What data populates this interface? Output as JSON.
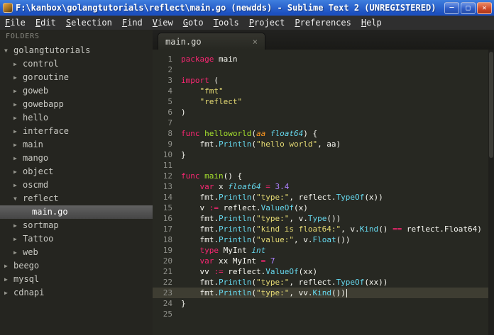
{
  "window": {
    "title": "F:\\kanbox\\golangtutorials\\reflect\\main.go (newdds) - Sublime Text 2 (UNREGISTERED)",
    "controls": {
      "minimize": "─",
      "maximize": "□",
      "close": "✕"
    }
  },
  "menu_items": [
    "File",
    "Edit",
    "Selection",
    "Find",
    "View",
    "Goto",
    "Tools",
    "Project",
    "Preferences",
    "Help"
  ],
  "sidebar": {
    "header": "FOLDERS",
    "items": [
      {
        "label": "golangtutorials",
        "level": 0,
        "type": "folder",
        "state": "expanded"
      },
      {
        "label": "control",
        "level": 1,
        "type": "folder",
        "state": "collapsed"
      },
      {
        "label": "goroutine",
        "level": 1,
        "type": "folder",
        "state": "collapsed"
      },
      {
        "label": "goweb",
        "level": 1,
        "type": "folder",
        "state": "collapsed"
      },
      {
        "label": "gowebapp",
        "level": 1,
        "type": "folder",
        "state": "collapsed"
      },
      {
        "label": "hello",
        "level": 1,
        "type": "folder",
        "state": "collapsed"
      },
      {
        "label": "interface",
        "level": 1,
        "type": "folder",
        "state": "collapsed"
      },
      {
        "label": "main",
        "level": 1,
        "type": "folder",
        "state": "collapsed"
      },
      {
        "label": "mango",
        "level": 1,
        "type": "folder",
        "state": "collapsed"
      },
      {
        "label": "object",
        "level": 1,
        "type": "folder",
        "state": "collapsed"
      },
      {
        "label": "oscmd",
        "level": 1,
        "type": "folder",
        "state": "collapsed"
      },
      {
        "label": "reflect",
        "level": 1,
        "type": "folder",
        "state": "expanded"
      },
      {
        "label": "main.go",
        "level": 2,
        "type": "file",
        "selected": true
      },
      {
        "label": "sortmap",
        "level": 1,
        "type": "folder",
        "state": "collapsed"
      },
      {
        "label": "Tattoo",
        "level": 1,
        "type": "folder",
        "state": "collapsed"
      },
      {
        "label": "web",
        "level": 1,
        "type": "folder",
        "state": "collapsed"
      },
      {
        "label": "beego",
        "level": 0,
        "type": "folder",
        "state": "collapsed"
      },
      {
        "label": "mysql",
        "level": 0,
        "type": "folder",
        "state": "collapsed"
      },
      {
        "label": "cdnapi",
        "level": 0,
        "type": "folder",
        "state": "collapsed"
      }
    ]
  },
  "tab": {
    "label": "main.go",
    "close_glyph": "×"
  },
  "editor": {
    "cursor_line": 23,
    "lines": [
      [
        [
          "package",
          "k"
        ],
        [
          " main",
          "p"
        ]
      ],
      [],
      [
        [
          "import",
          "k"
        ],
        [
          " (",
          "p"
        ]
      ],
      [
        [
          "    ",
          "p"
        ],
        [
          "\"fmt\"",
          "s"
        ]
      ],
      [
        [
          "    ",
          "p"
        ],
        [
          "\"reflect\"",
          "s"
        ]
      ],
      [
        [
          ")",
          "p"
        ]
      ],
      [],
      [
        [
          "func",
          "k"
        ],
        [
          " ",
          "p"
        ],
        [
          "helloworld",
          "f"
        ],
        [
          "(",
          "p"
        ],
        [
          "aa",
          "a"
        ],
        [
          " ",
          "p"
        ],
        [
          "float64",
          "t"
        ],
        [
          ") {",
          "p"
        ]
      ],
      [
        [
          "    fmt.",
          "p"
        ],
        [
          "Println",
          "b"
        ],
        [
          "(",
          "p"
        ],
        [
          "\"hello world\"",
          "s"
        ],
        [
          ", aa)",
          "p"
        ]
      ],
      [
        [
          "}",
          "p"
        ]
      ],
      [],
      [
        [
          "func",
          "k"
        ],
        [
          " ",
          "p"
        ],
        [
          "main",
          "f"
        ],
        [
          "() {",
          "p"
        ]
      ],
      [
        [
          "    ",
          "p"
        ],
        [
          "var",
          "k"
        ],
        [
          " x ",
          "p"
        ],
        [
          "float64",
          "t"
        ],
        [
          " ",
          "p"
        ],
        [
          "=",
          "o"
        ],
        [
          " ",
          "p"
        ],
        [
          "3.4",
          "n"
        ]
      ],
      [
        [
          "    fmt.",
          "p"
        ],
        [
          "Println",
          "b"
        ],
        [
          "(",
          "p"
        ],
        [
          "\"type:\"",
          "s"
        ],
        [
          ", reflect.",
          "p"
        ],
        [
          "TypeOf",
          "b"
        ],
        [
          "(x))",
          "p"
        ]
      ],
      [
        [
          "    v ",
          "p"
        ],
        [
          ":=",
          "o"
        ],
        [
          " reflect.",
          "p"
        ],
        [
          "ValueOf",
          "b"
        ],
        [
          "(x)",
          "p"
        ]
      ],
      [
        [
          "    fmt.",
          "p"
        ],
        [
          "Println",
          "b"
        ],
        [
          "(",
          "p"
        ],
        [
          "\"type:\"",
          "s"
        ],
        [
          ", v.",
          "p"
        ],
        [
          "Type",
          "b"
        ],
        [
          "())",
          "p"
        ]
      ],
      [
        [
          "    fmt.",
          "p"
        ],
        [
          "Println",
          "b"
        ],
        [
          "(",
          "p"
        ],
        [
          "\"kind is float64:\"",
          "s"
        ],
        [
          ", v.",
          "p"
        ],
        [
          "Kind",
          "b"
        ],
        [
          "() ",
          "p"
        ],
        [
          "==",
          "o"
        ],
        [
          " reflect.Float64)",
          "p"
        ]
      ],
      [
        [
          "    fmt.",
          "p"
        ],
        [
          "Println",
          "b"
        ],
        [
          "(",
          "p"
        ],
        [
          "\"value:\"",
          "s"
        ],
        [
          ", v.",
          "p"
        ],
        [
          "Float",
          "b"
        ],
        [
          "())",
          "p"
        ]
      ],
      [
        [
          "    ",
          "p"
        ],
        [
          "type",
          "k"
        ],
        [
          " MyInt ",
          "p"
        ],
        [
          "int",
          "t"
        ]
      ],
      [
        [
          "    ",
          "p"
        ],
        [
          "var",
          "k"
        ],
        [
          " xx MyInt ",
          "p"
        ],
        [
          "=",
          "o"
        ],
        [
          " ",
          "p"
        ],
        [
          "7",
          "n"
        ]
      ],
      [
        [
          "    vv ",
          "p"
        ],
        [
          ":=",
          "o"
        ],
        [
          " reflect.",
          "p"
        ],
        [
          "ValueOf",
          "b"
        ],
        [
          "(xx)",
          "p"
        ]
      ],
      [
        [
          "    fmt.",
          "p"
        ],
        [
          "Println",
          "b"
        ],
        [
          "(",
          "p"
        ],
        [
          "\"type:\"",
          "s"
        ],
        [
          ", reflect.",
          "p"
        ],
        [
          "TypeOf",
          "b"
        ],
        [
          "(xx))",
          "p"
        ]
      ],
      [
        [
          "    fmt.",
          "p"
        ],
        [
          "Println",
          "b"
        ],
        [
          "(",
          "p"
        ],
        [
          "\"type:\"",
          "s"
        ],
        [
          ", vv.",
          "p"
        ],
        [
          "Kind",
          "b"
        ],
        [
          "())",
          "p"
        ]
      ],
      [
        [
          "}",
          "p"
        ]
      ],
      []
    ]
  },
  "colors": {
    "titlebar-top": "#3f7ede",
    "titlebar-bottom": "#1c50c0",
    "close-btn": "#cf4a2a",
    "menubar-bg": "#2f2f2f",
    "sidebar-bg": "#252520",
    "selected-top": "#616161",
    "selected-bottom": "#464646",
    "tabbar-bg": "#1a1a17",
    "editor-bg": "#272822",
    "cur-line": "#3e3d32",
    "gutter": "#8f908a",
    "fg": "#f8f8f2",
    "kw": "#f92672",
    "str": "#e6db74",
    "num": "#ae81ff",
    "fn": "#a6e22e",
    "typ": "#66d9ef",
    "builtin": "#66d9ef",
    "op": "#f92672",
    "param": "#fd971f"
  }
}
